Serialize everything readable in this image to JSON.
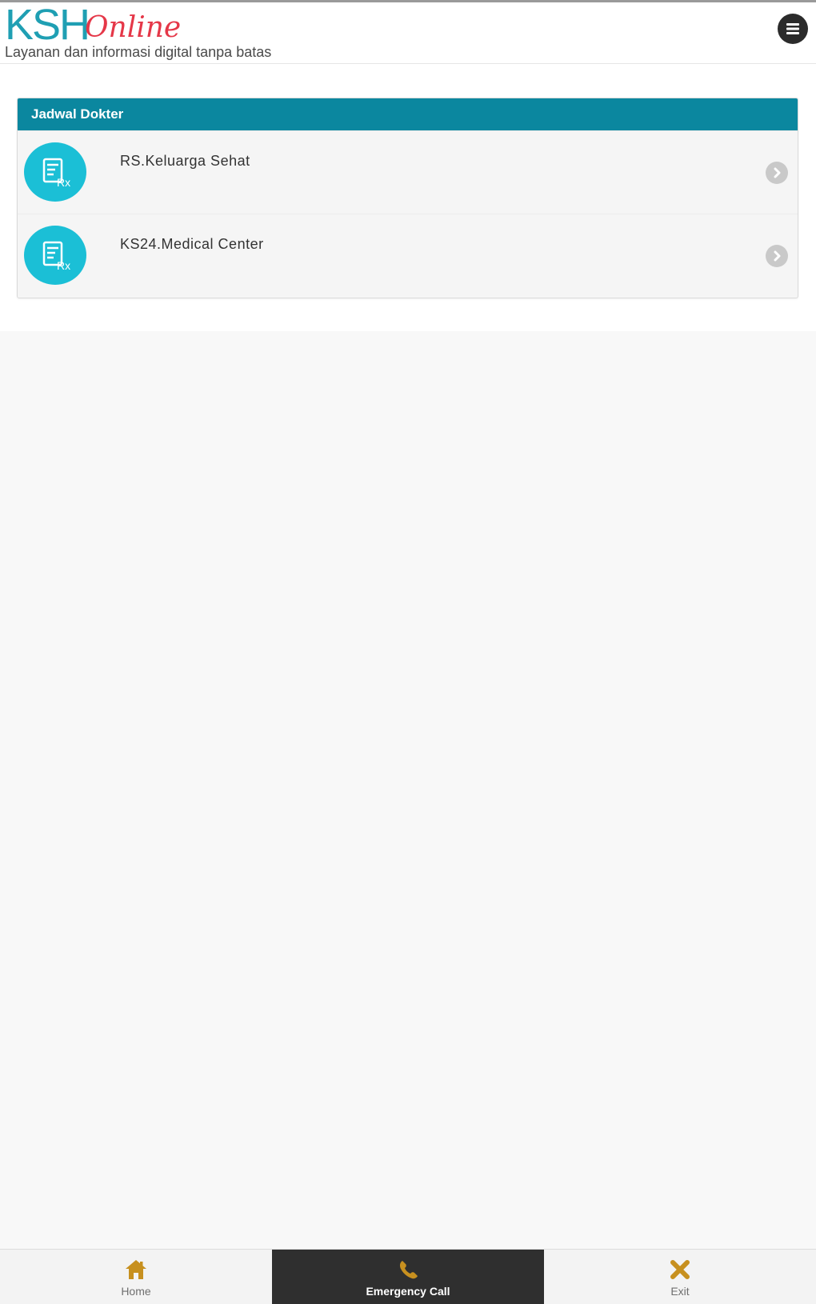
{
  "header": {
    "logo_ksh": "KSH",
    "logo_online": "Online",
    "tagline": "Layanan dan informasi digital tanpa batas"
  },
  "panel": {
    "title": "Jadwal Dokter",
    "items": [
      {
        "label": "RS.Keluarga Sehat",
        "icon": "prescription-icon"
      },
      {
        "label": "KS24.Medical Center",
        "icon": "prescription-icon"
      }
    ]
  },
  "footer": {
    "home_label": "Home",
    "emergency_label": "Emergency Call",
    "exit_label": "Exit"
  },
  "colors": {
    "brand_teal": "#1f9fb3",
    "brand_red": "#e53748",
    "panel_header": "#0b879f",
    "icon_circle": "#1bbfd6",
    "nav_icon": "#c7901f",
    "nav_active_bg": "#2f2f2f"
  }
}
